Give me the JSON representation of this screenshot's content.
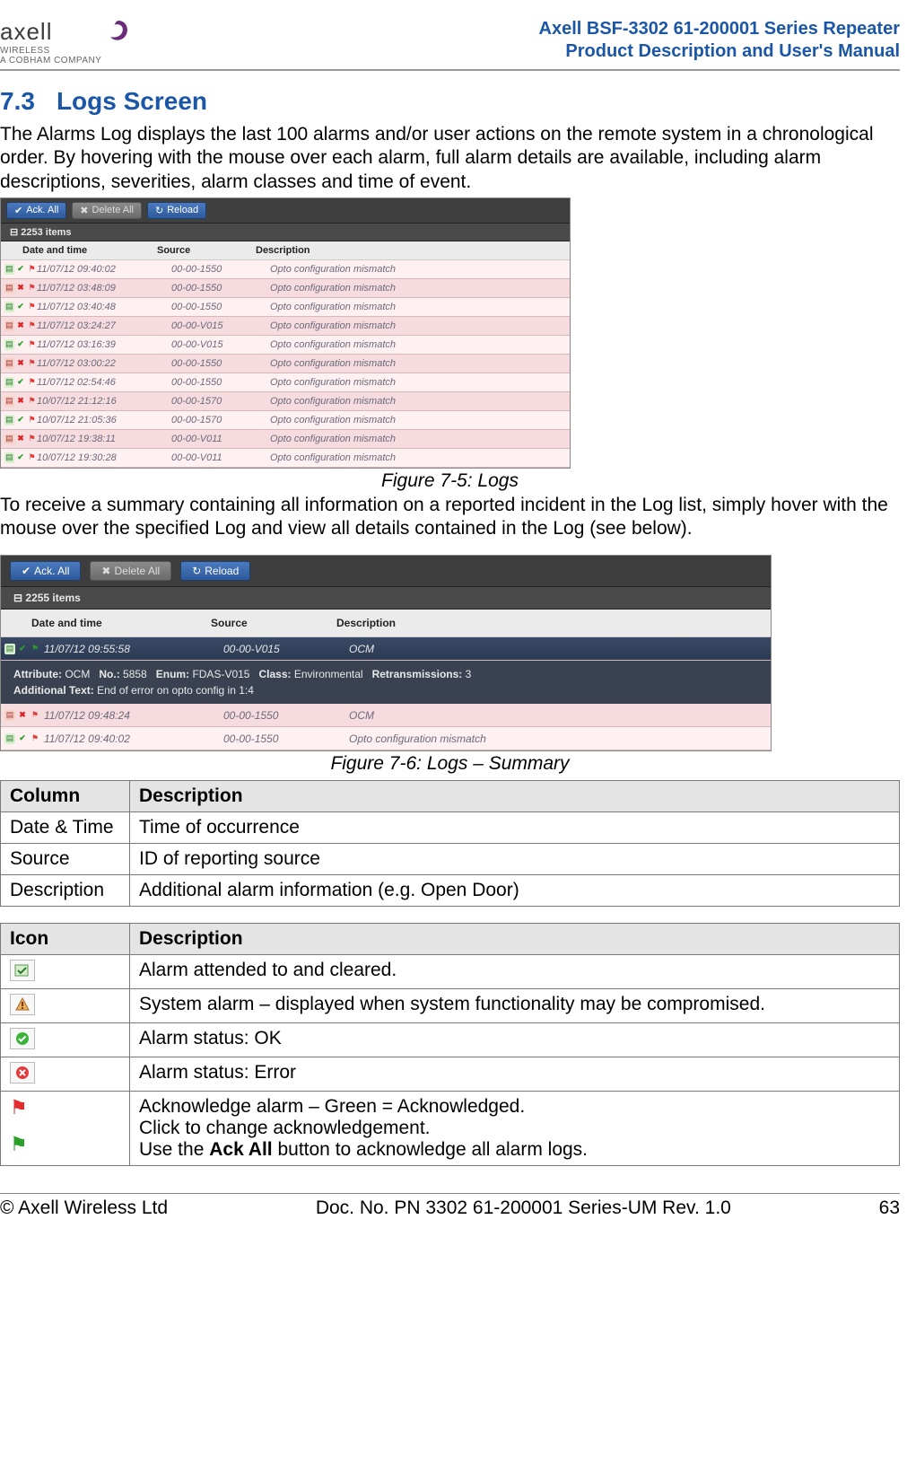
{
  "header": {
    "logo_text": "axell",
    "logo_sub1": "WIRELESS",
    "logo_sub2": "A COBHAM COMPANY",
    "title_line1": "Axell BSF-3302 61-200001 Series Repeater",
    "title_line2": "Product Description and User's Manual"
  },
  "section": {
    "number": "7.3",
    "title": "Logs Screen"
  },
  "paragraph1": "The Alarms Log displays the last 100 alarms and/or user actions on the remote system in a chronological order. By hovering with the mouse over each alarm, full alarm details are available, including alarm descriptions, severities, alarm classes and time of event.",
  "screenshot1": {
    "btn_ack": "Ack. All",
    "btn_delete": "Delete All",
    "btn_reload": "Reload",
    "items_count": "2253 items",
    "col_dt": "Date and time",
    "col_src": "Source",
    "col_desc": "Description",
    "rows": [
      {
        "style": "ok",
        "dt": "11/07/12 09:40:02",
        "src": "00-00-1550",
        "desc": "Opto configuration mismatch"
      },
      {
        "style": "err",
        "dt": "11/07/12 03:48:09",
        "src": "00-00-1550",
        "desc": "Opto configuration mismatch"
      },
      {
        "style": "ok",
        "dt": "11/07/12 03:40:48",
        "src": "00-00-1550",
        "desc": "Opto configuration mismatch"
      },
      {
        "style": "err",
        "dt": "11/07/12 03:24:27",
        "src": "00-00-V015",
        "desc": "Opto configuration mismatch"
      },
      {
        "style": "ok",
        "dt": "11/07/12 03:16:39",
        "src": "00-00-V015",
        "desc": "Opto configuration mismatch"
      },
      {
        "style": "err",
        "dt": "11/07/12 03:00:22",
        "src": "00-00-1550",
        "desc": "Opto configuration mismatch"
      },
      {
        "style": "ok",
        "dt": "11/07/12 02:54:46",
        "src": "00-00-1550",
        "desc": "Opto configuration mismatch"
      },
      {
        "style": "err",
        "dt": "10/07/12 21:12:16",
        "src": "00-00-1570",
        "desc": "Opto configuration mismatch"
      },
      {
        "style": "ok",
        "dt": "10/07/12 21:05:36",
        "src": "00-00-1570",
        "desc": "Opto configuration mismatch"
      },
      {
        "style": "err",
        "dt": "10/07/12 19:38:11",
        "src": "00-00-V011",
        "desc": "Opto configuration mismatch"
      },
      {
        "style": "ok",
        "dt": "10/07/12 19:30:28",
        "src": "00-00-V011",
        "desc": "Opto configuration mismatch"
      }
    ]
  },
  "caption1": "Figure 7-5:  Logs",
  "paragraph2": "To receive a summary containing all information on a reported incident in the Log list, simply hover with the mouse over the specified Log and view all details contained in the Log (see below).",
  "screenshot2": {
    "btn_ack": "Ack. All",
    "btn_delete": "Delete All",
    "btn_reload": "Reload",
    "items_count": "2255 items",
    "col_dt": "Date and time",
    "col_src": "Source",
    "col_desc": "Description",
    "sel": {
      "dt": "11/07/12 09:55:58",
      "src": "00-00-V015",
      "desc": "OCM"
    },
    "hb_attr_l": "Attribute:",
    "hb_attr_v": "OCM",
    "hb_no_l": "No.:",
    "hb_no_v": "5858",
    "hb_enum_l": "Enum:",
    "hb_enum_v": "FDAS-V015",
    "hb_class_l": "Class:",
    "hb_class_v": "Environmental",
    "hb_ret_l": "Retransmissions:",
    "hb_ret_v": "3",
    "hb_add_l": "Additional Text:",
    "hb_add_v": "End of error on opto config in 1:4",
    "row2": {
      "dt": "11/07/12 09:48:24",
      "src": "00-00-1550",
      "desc": "OCM"
    },
    "row3": {
      "dt": "11/07/12 09:40:02",
      "src": "00-00-1550",
      "desc": "Opto configuration mismatch"
    }
  },
  "caption2": "Figure 7-6: Logs – Summary",
  "table1": {
    "h1": "Column",
    "h2": "Description",
    "r1c1": "Date & Time",
    "r1c2": "Time of occurrence",
    "r2c1": "Source",
    "r2c2": "ID of reporting source",
    "r3c1": "Description",
    "r3c2": "Additional alarm information (e.g. Open Door)"
  },
  "table2": {
    "h1": "Icon",
    "h2": "Description",
    "r1": "Alarm attended to and cleared.",
    "r2": "System alarm – displayed when system functionality may be compromised.",
    "r3": "Alarm status: OK",
    "r4": "Alarm status: Error",
    "r5a": "Acknowledge alarm – Green = Acknowledged.",
    "r5b": "Click to change acknowledgement.",
    "r5c_pre": "Use the ",
    "r5c_bold": "Ack All",
    "r5c_post": " button to acknowledge all alarm logs."
  },
  "footer": {
    "left": "© Axell Wireless Ltd",
    "center": "Doc. No. PN 3302 61-200001 Series-UM Rev. 1.0",
    "right": "63"
  }
}
